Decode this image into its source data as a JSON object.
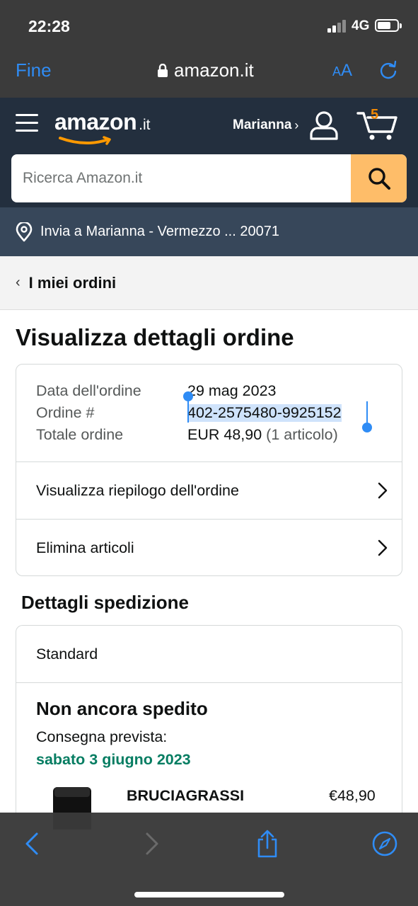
{
  "status_bar": {
    "time": "22:28",
    "network": "4G"
  },
  "safari": {
    "done_label": "Fine",
    "url": "amazon.it",
    "text_size_label_small": "A",
    "text_size_label_large": "A"
  },
  "header": {
    "logo_text": "amazon",
    "logo_tld": ".it",
    "account_name": "Marianna",
    "account_chevron": "›",
    "cart_count": "5",
    "search_placeholder": "Ricerca Amazon.it"
  },
  "delivery": {
    "text": "Invia a Marianna - Vermezzo ... 20071"
  },
  "breadcrumb": {
    "chevron": "‹",
    "label": "I miei ordini"
  },
  "page_title": "Visualizza dettagli ordine",
  "order": {
    "date_label": "Data dell'ordine",
    "date_value": "29 mag 2023",
    "number_label": "Ordine #",
    "number_value": "402-2575480-9925152",
    "total_label": "Totale ordine",
    "total_value": "EUR 48,90",
    "total_extra": "(1 articolo)",
    "summary_link": "Visualizza riepilogo dell'ordine",
    "remove_link": "Elimina articoli"
  },
  "shipping": {
    "section_title": "Dettagli spedizione",
    "method": "Standard",
    "status": "Non ancora spedito",
    "expected_label": "Consegna prevista:",
    "expected_date": "sabato 3 giugno 2023",
    "product_name": "BRUCIAGRASSI",
    "product_price": "€48,90"
  },
  "colors": {
    "safari_bar": "#3b3b3b",
    "amazon_header": "#232f3e",
    "delivery_bar": "#37475a",
    "search_button": "#febd69",
    "ios_blue": "#2f8cf5",
    "delivery_green": "#067d62",
    "cart_orange": "#f08804"
  },
  "icons": {
    "lock": "lock-icon",
    "reload": "reload-icon",
    "menu": "hamburger-menu-icon",
    "user": "user-icon",
    "cart": "cart-icon",
    "search": "search-icon",
    "location": "location-pin-icon",
    "back": "back-arrow-icon",
    "forward": "forward-arrow-icon",
    "share": "share-icon",
    "compass": "compass-icon"
  }
}
